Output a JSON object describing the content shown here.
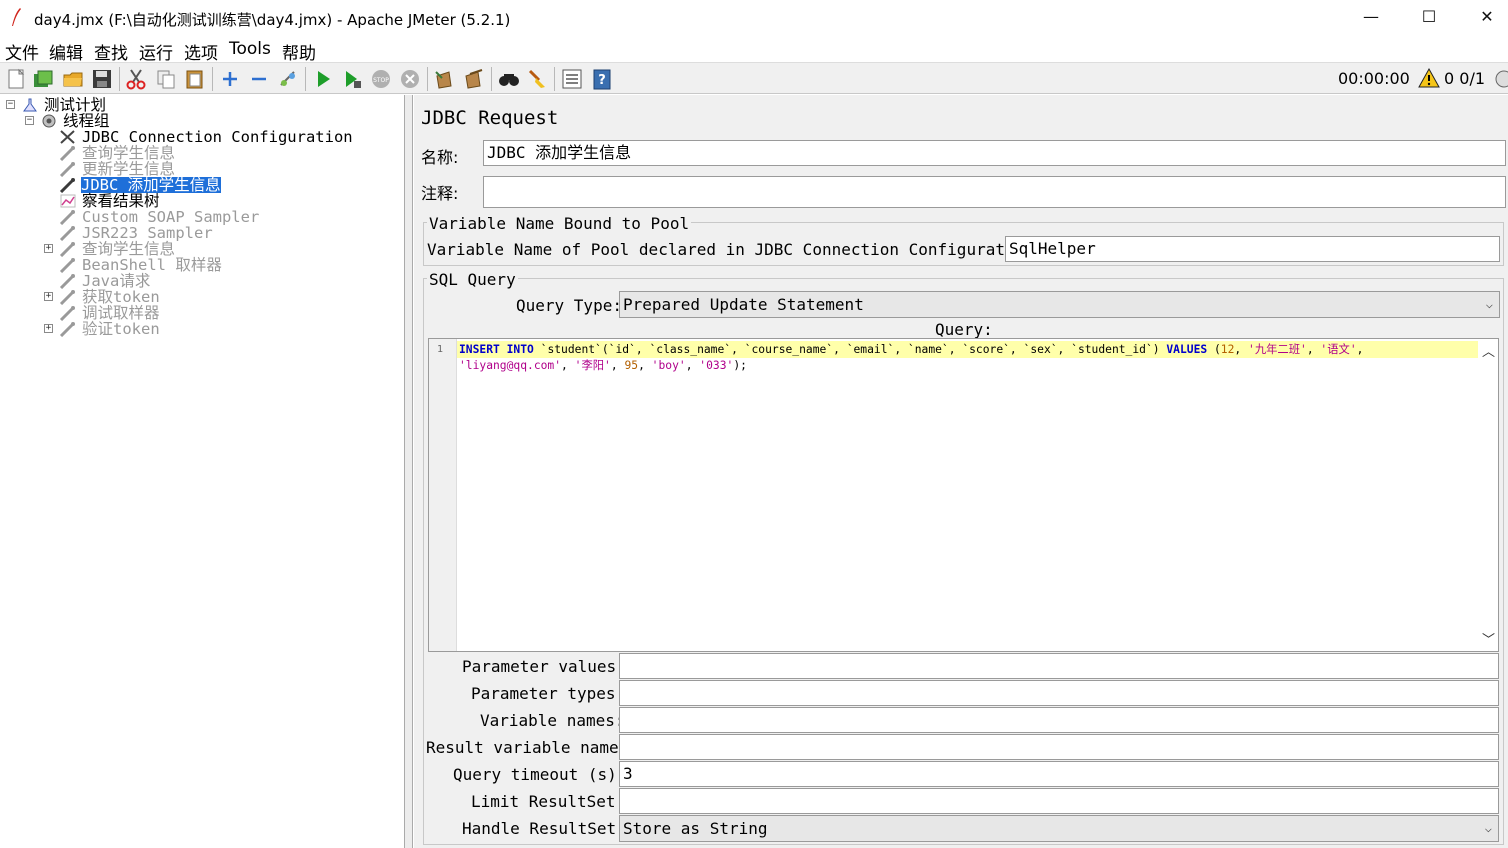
{
  "window": {
    "title": "day4.jmx (F:\\自动化测试训练营\\day4.jmx) - Apache JMeter (5.2.1)",
    "minimize": "—",
    "maximize": "☐",
    "close": "✕"
  },
  "menu": [
    "文件",
    "编辑",
    "查找",
    "运行",
    "选项",
    "Tools",
    "帮助"
  ],
  "toolbar": {
    "icons": [
      "new-icon",
      "templates-icon",
      "open-icon",
      "save-icon",
      "cut-icon",
      "copy-icon",
      "paste-icon",
      "expand-icon",
      "collapse-icon",
      "toggle-icon",
      "start-icon",
      "start-no-pause-icon",
      "stop-icon",
      "shutdown-icon",
      "clear-icon",
      "clear-all-icon",
      "search-icon",
      "reset-search-icon",
      "function-helper-icon",
      "help-icon"
    ],
    "timer": "00:00:00",
    "warning_count": "0",
    "threads": "0/1"
  },
  "tree": {
    "root": "测试计划",
    "thread_group": "线程组",
    "items": [
      {
        "label": "JDBC Connection Configuration",
        "state": "enabled"
      },
      {
        "label": "查询学生信息",
        "state": "disabled"
      },
      {
        "label": "更新学生信息",
        "state": "disabled"
      },
      {
        "label": "JDBC 添加学生信息",
        "state": "selected"
      },
      {
        "label": "察看结果树",
        "state": "enabled"
      },
      {
        "label": "Custom SOAP Sampler",
        "state": "disabled"
      },
      {
        "label": "JSR223 Sampler",
        "state": "disabled"
      },
      {
        "label": "查询学生信息",
        "state": "disabled"
      },
      {
        "label": "BeanShell 取样器",
        "state": "disabled"
      },
      {
        "label": "Java请求",
        "state": "disabled"
      },
      {
        "label": "获取token",
        "state": "disabled"
      },
      {
        "label": "调试取样器",
        "state": "disabled"
      },
      {
        "label": "验证token",
        "state": "disabled"
      }
    ]
  },
  "panel": {
    "heading": "JDBC Request",
    "name_label": "名称:",
    "name_value": "JDBC 添加学生信息",
    "comment_label": "注释:",
    "comment_value": "",
    "pool_group_title": "Variable Name Bound to Pool",
    "pool_label": "Variable Name of Pool declared in JDBC Connection Configuration:",
    "pool_value": "SqlHelper",
    "sql_group_title": "SQL Query",
    "query_type_label": "Query Type:",
    "query_type_value": "Prepared Update Statement",
    "query_label": "Query:",
    "query_line_number": "1",
    "params": {
      "parameter_values_label": "Parameter values:",
      "parameter_values": "",
      "parameter_types_label": "Parameter types:",
      "parameter_types": "",
      "variable_names_label": "Variable names:",
      "variable_names": "",
      "result_variable_label": "Result variable name:",
      "result_variable": "",
      "timeout_label": "Query timeout (s):",
      "timeout": "3",
      "limit_label": "Limit ResultSet:",
      "limit": "",
      "handle_label": "Handle ResultSet:",
      "handle": "Store as String"
    }
  }
}
